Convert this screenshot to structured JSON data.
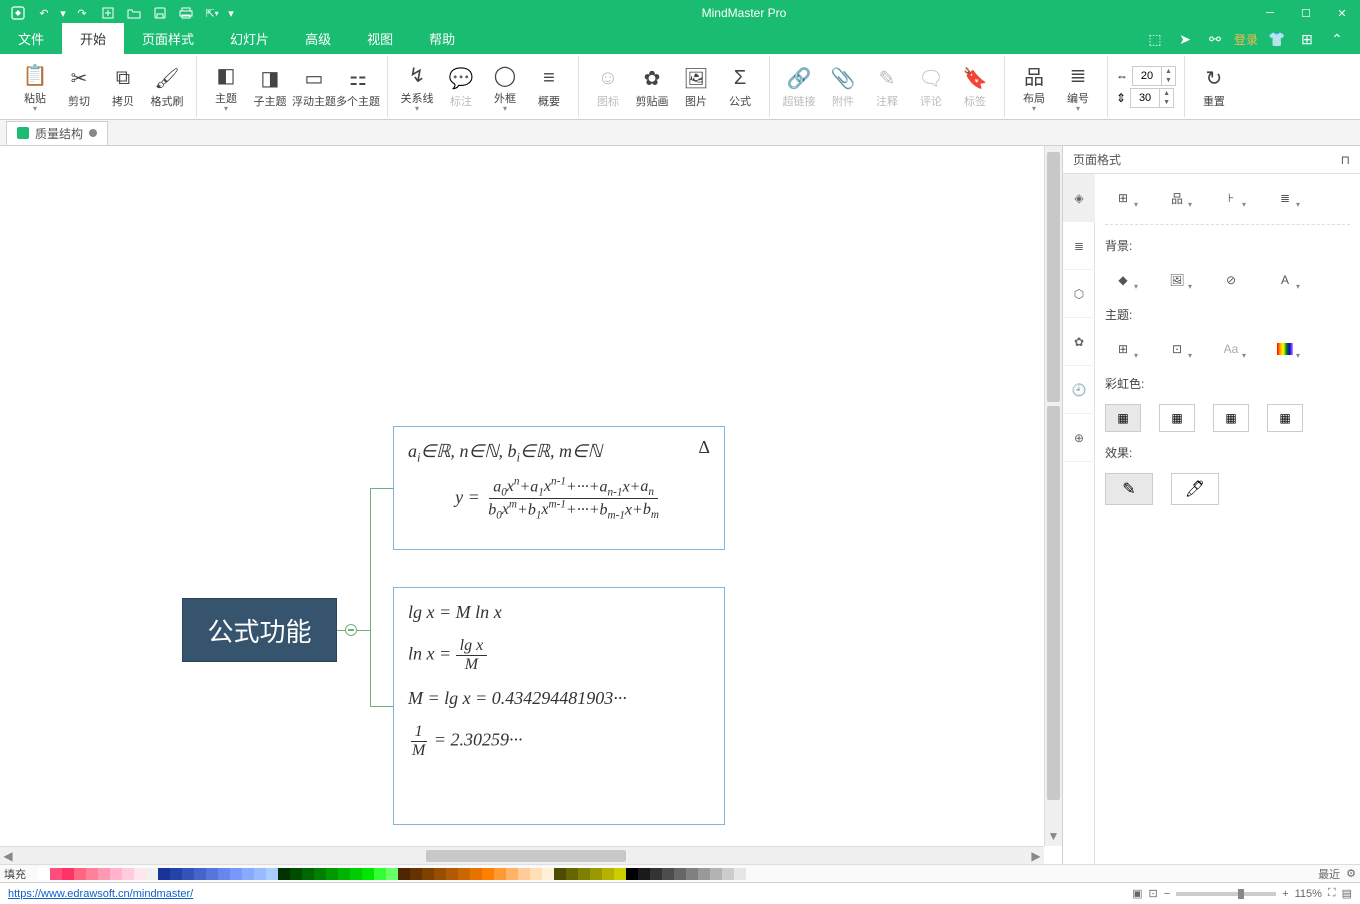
{
  "app_title": "MindMaster Pro",
  "menus": {
    "file": "文件",
    "home": "开始",
    "page_style": "页面样式",
    "slideshow": "幻灯片",
    "advanced": "高级",
    "view": "视图",
    "help": "帮助"
  },
  "login_label": "登录",
  "ribbon": {
    "paste": "粘贴",
    "cut": "剪切",
    "copy": "拷贝",
    "format_painter": "格式刷",
    "topic": "主题",
    "subtopic": "子主题",
    "floating": "浮动主题",
    "multiple": "多个主题",
    "relation": "关系线",
    "callout": "标注",
    "boundary": "外框",
    "summary": "概要",
    "icon": "图标",
    "clipart": "剪贴画",
    "picture": "图片",
    "formula": "公式",
    "hyperlink": "超链接",
    "attachment": "附件",
    "note": "注释",
    "comment": "评论",
    "tag": "标签",
    "layout": "布局",
    "number": "编号",
    "reset": "重置",
    "spin1": "20",
    "spin2": "30"
  },
  "doc_tab": "质量结构",
  "canvas": {
    "central": "公式功能",
    "formula1_line1": "aᵢ∈ℝ, n∈ℕ, bᵢ∈ℝ, m∈ℕ",
    "formula1_num": "a₀xⁿ+a₁xⁿ⁻¹+···+aₙ₋₁x+aₙ",
    "formula1_den": "b₀xᵐ+b₁xᵐ⁻¹+···+bₘ₋₁x+bₘ",
    "delta": "Δ",
    "f2_l1": "lg x = M ln x",
    "f2_l2_lhs": "ln x =",
    "f2_l2_num": "lg x",
    "f2_l2_den": "M",
    "f2_l3": "M = lg x = 0.434294481903···",
    "f2_l4_num": "1",
    "f2_l4_den": "M",
    "f2_l4_rhs": "= 2.30259···"
  },
  "side_panel": {
    "title": "页面格式",
    "bg_label": "背景:",
    "theme_label": "主题:",
    "rainbow_label": "彩虹色:",
    "effect_label": "效果:"
  },
  "color_strip_label": "填充",
  "color_strip_recent": "最近",
  "status_url": "https://www.edrawsoft.cn/mindmaster/",
  "zoom": "115%",
  "swatch_colors": [
    "#ffffff",
    "#ff4d7d",
    "#ff3366",
    "#ff6680",
    "#ff8099",
    "#ff99b3",
    "#ffb3cc",
    "#ffccdd",
    "#ffe6ee",
    "#f0f0f0",
    "#1a3399",
    "#2244aa",
    "#3355bb",
    "#4466cc",
    "#5577dd",
    "#6688ee",
    "#7799ff",
    "#88aaff",
    "#99bbff",
    "#aaccff",
    "#003300",
    "#004d00",
    "#006600",
    "#008000",
    "#009900",
    "#00b300",
    "#00cc00",
    "#00e600",
    "#33ff33",
    "#66ff66",
    "#4d2600",
    "#663300",
    "#804000",
    "#994d00",
    "#b35900",
    "#cc6600",
    "#e67300",
    "#ff8000",
    "#ff9933",
    "#ffb366",
    "#ffcc99",
    "#ffe0b3",
    "#fff0d9",
    "#4d4d00",
    "#666600",
    "#808000",
    "#999900",
    "#b3b300",
    "#cccc00",
    "#000000",
    "#1a1a1a",
    "#333333",
    "#4d4d4d",
    "#666666",
    "#808080",
    "#999999",
    "#b3b3b3",
    "#cccccc",
    "#e6e6e6"
  ]
}
